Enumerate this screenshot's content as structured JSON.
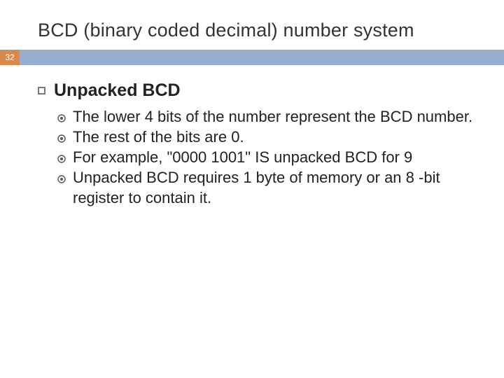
{
  "slide": {
    "title": "BCD (binary coded decimal) number system",
    "number": "32",
    "heading": "Unpacked BCD",
    "items": [
      "The lower 4 bits of the number represent the BCD number.",
      "The rest of the bits are 0.",
      "For example, \"0000 1001\" IS unpacked BCD for 9",
      "Unpacked BCD requires 1 byte of memory or an 8 -bit register to contain it."
    ]
  }
}
